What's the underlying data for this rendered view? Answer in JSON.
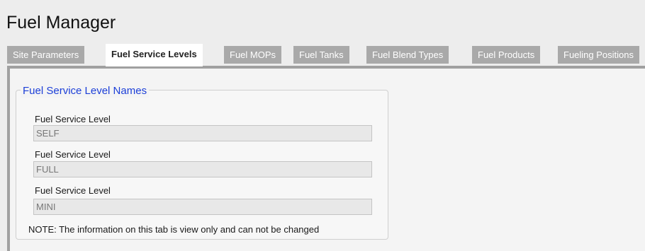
{
  "app": {
    "title": "Fuel Manager"
  },
  "tabs": [
    {
      "label": "Site Parameters",
      "active": false
    },
    {
      "label": "Fuel Service Levels",
      "active": true
    },
    {
      "label": "Fuel MOPs",
      "active": false
    },
    {
      "label": "Fuel Tanks",
      "active": false
    },
    {
      "label": "Fuel Blend Types",
      "active": false
    },
    {
      "label": "Fuel Products",
      "active": false
    },
    {
      "label": "Fueling Positions",
      "active": false
    }
  ],
  "section": {
    "legend": "Fuel Service Level Names",
    "fields": [
      {
        "label": "Fuel Service Level",
        "value": "SELF"
      },
      {
        "label": "Fuel Service Level",
        "value": "FULL"
      },
      {
        "label": "Fuel Service Level",
        "value": "MINI"
      }
    ],
    "note": "NOTE: The information on this tab is view only and can not be changed"
  },
  "colors": {
    "legend_text": "#1c3fd8",
    "tab_inactive_bg": "#a9a9a9",
    "tab_active_bg": "#ffffff",
    "page_bg": "#ededed"
  }
}
